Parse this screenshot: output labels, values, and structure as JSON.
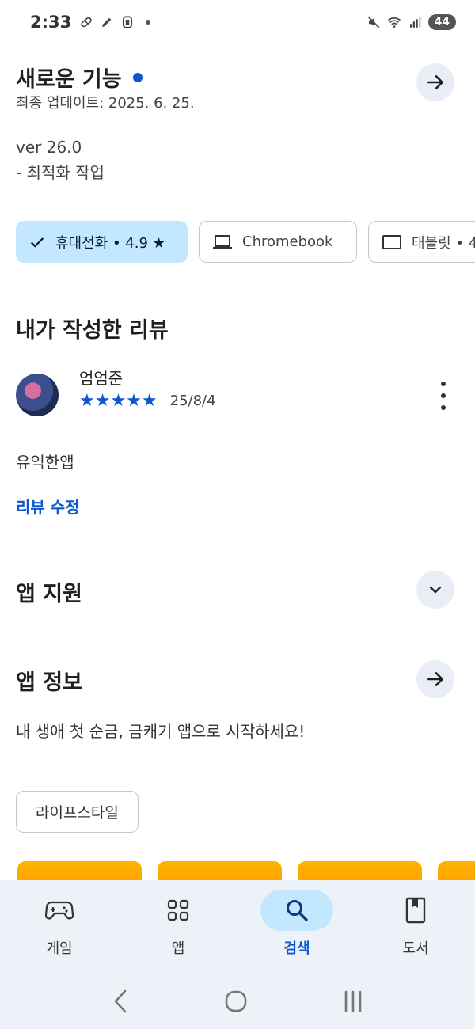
{
  "status_bar": {
    "time": "2:33",
    "battery": "44"
  },
  "whats_new": {
    "title": "새로운 기능",
    "last_updated": "최종 업데이트: 2025. 6. 25.",
    "version": "ver 26.0",
    "notes": "- 최적화 작업"
  },
  "device_chips": [
    {
      "label": "휴대전화 • 4.9 ★",
      "selected": true
    },
    {
      "label": "Chromebook",
      "selected": false
    },
    {
      "label": "태블릿 • 4",
      "selected": false
    }
  ],
  "my_review": {
    "title": "내가 작성한 리뷰",
    "author": "엄엄준",
    "stars": "★★★★★",
    "date": "25/8/4",
    "text": "유익한앱",
    "edit_label": "리뷰 수정"
  },
  "app_support": {
    "title": "앱 지원"
  },
  "app_info": {
    "title": "앱 정보",
    "description": "내 생애 첫 순금, 금캐기 앱으로 시작하세요!",
    "category_tag": "라이프스타일"
  },
  "bottom_nav": [
    {
      "label": "게임",
      "icon": "gamepad-icon",
      "active": false
    },
    {
      "label": "앱",
      "icon": "apps-grid-icon",
      "active": false
    },
    {
      "label": "검색",
      "icon": "search-icon",
      "active": true
    },
    {
      "label": "도서",
      "icon": "book-icon",
      "active": false
    }
  ],
  "colors": {
    "accent": "#0b57d0",
    "chip_selected": "#c2e7ff",
    "nav_bg": "#edf1f8"
  }
}
